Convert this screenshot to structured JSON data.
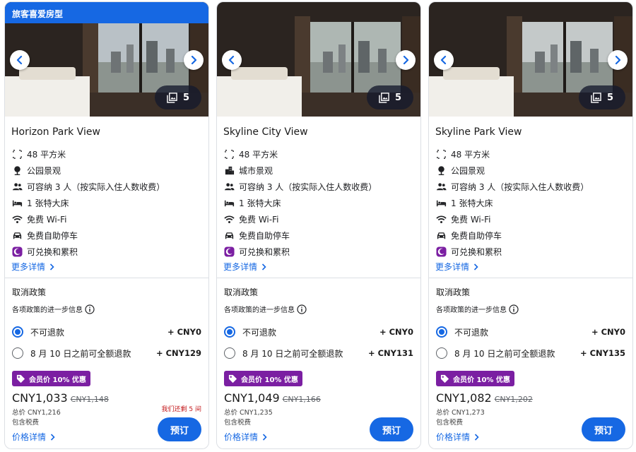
{
  "colors": {
    "accent": "#1668e3",
    "member_purple": "#7b1fa2",
    "scarcity_red": "#c3181b"
  },
  "cards": [
    {
      "badge": "旅客喜爱房型",
      "photo_count": "5",
      "name": "Horizon Park View",
      "features": [
        {
          "icon": "area-icon",
          "text": "48 平方米"
        },
        {
          "icon": "park-icon",
          "text": "公园景观"
        },
        {
          "icon": "people-icon",
          "text": "可容纳 3 人（按实际入住人数收费）"
        },
        {
          "icon": "bed-icon",
          "text": "1 张特大床"
        },
        {
          "icon": "wifi-icon",
          "text": "免费 Wi-Fi"
        },
        {
          "icon": "car-icon",
          "text": "免费自助停车"
        },
        {
          "icon": "moon-icon",
          "text": "可兑换和累积"
        }
      ],
      "more_details": "更多详情",
      "cancel_title": "取消政策",
      "cancel_info": "各项政策的进一步信息",
      "options": [
        {
          "label": "不可退款",
          "price": "+ CNY0",
          "selected": true
        },
        {
          "label": "8 月 10 日之前可全额退款",
          "price": "+ CNY129",
          "selected": false
        }
      ],
      "member_badge": "会员价 10% 优惠",
      "price_now": "CNY1,033",
      "price_old": "CNY1,148",
      "total": "总价 CNY1,216",
      "tax": "包含税费",
      "price_details": "价格详情",
      "scarcity": "我们还剩 5 间",
      "book": "预订"
    },
    {
      "badge": "",
      "photo_count": "5",
      "name": "Skyline City View",
      "features": [
        {
          "icon": "area-icon",
          "text": "48 平方米"
        },
        {
          "icon": "city-icon",
          "text": "城市景观"
        },
        {
          "icon": "people-icon",
          "text": "可容纳 3 人（按实际入住人数收费）"
        },
        {
          "icon": "bed-icon",
          "text": "1 张特大床"
        },
        {
          "icon": "wifi-icon",
          "text": "免费 Wi-Fi"
        },
        {
          "icon": "car-icon",
          "text": "免费自助停车"
        },
        {
          "icon": "moon-icon",
          "text": "可兑换和累积"
        }
      ],
      "more_details": "更多详情",
      "cancel_title": "取消政策",
      "cancel_info": "各项政策的进一步信息",
      "options": [
        {
          "label": "不可退款",
          "price": "+ CNY0",
          "selected": true
        },
        {
          "label": "8 月 10 日之前可全额退款",
          "price": "+ CNY131",
          "selected": false
        }
      ],
      "member_badge": "会员价 10% 优惠",
      "price_now": "CNY1,049",
      "price_old": "CNY1,166",
      "total": "总价 CNY1,235",
      "tax": "包含税费",
      "price_details": "价格详情",
      "scarcity": "",
      "book": "预订"
    },
    {
      "badge": "",
      "photo_count": "5",
      "name": "Skyline Park View",
      "features": [
        {
          "icon": "area-icon",
          "text": "48 平方米"
        },
        {
          "icon": "park-icon",
          "text": "公园景观"
        },
        {
          "icon": "people-icon",
          "text": "可容纳 3 人（按实际入住人数收费）"
        },
        {
          "icon": "bed-icon",
          "text": "1 张特大床"
        },
        {
          "icon": "wifi-icon",
          "text": "免费 Wi-Fi"
        },
        {
          "icon": "car-icon",
          "text": "免费自助停车"
        },
        {
          "icon": "moon-icon",
          "text": "可兑换和累积"
        }
      ],
      "more_details": "更多详情",
      "cancel_title": "取消政策",
      "cancel_info": "各项政策的进一步信息",
      "options": [
        {
          "label": "不可退款",
          "price": "+ CNY0",
          "selected": true
        },
        {
          "label": "8 月 10 日之前可全额退款",
          "price": "+ CNY135",
          "selected": false
        }
      ],
      "member_badge": "会员价 10% 优惠",
      "price_now": "CNY1,082",
      "price_old": "CNY1,202",
      "total": "总价 CNY1,273",
      "tax": "包含税费",
      "price_details": "价格详情",
      "scarcity": "",
      "book": "预订"
    }
  ]
}
